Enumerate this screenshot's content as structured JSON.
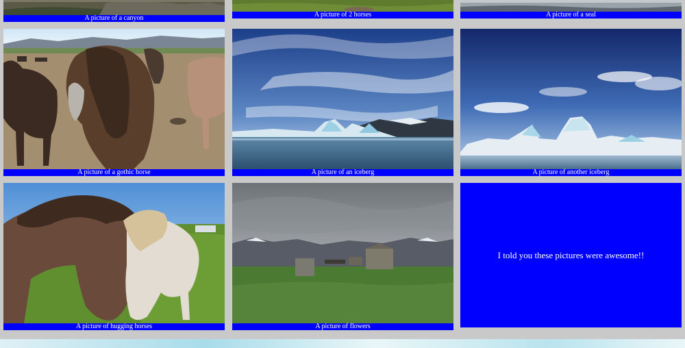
{
  "gallery": {
    "top_row": [
      {
        "caption": "A picture of a canyon"
      },
      {
        "caption": "A picture of 2 horses"
      },
      {
        "caption": "A picture of a seal"
      }
    ],
    "cards": [
      {
        "caption": "A picture of a gothic horse"
      },
      {
        "caption": "A picture of an iceberg"
      },
      {
        "caption": "A picture of another iceberg"
      },
      {
        "caption": "A picture of hugging horses"
      },
      {
        "caption": "A picture of flowers"
      }
    ],
    "message": "I told you these pictures were awesome!!"
  },
  "colors": {
    "background": "#c9c9c9",
    "caption_bar": "#0000ff",
    "caption_text": "#ffffff"
  }
}
